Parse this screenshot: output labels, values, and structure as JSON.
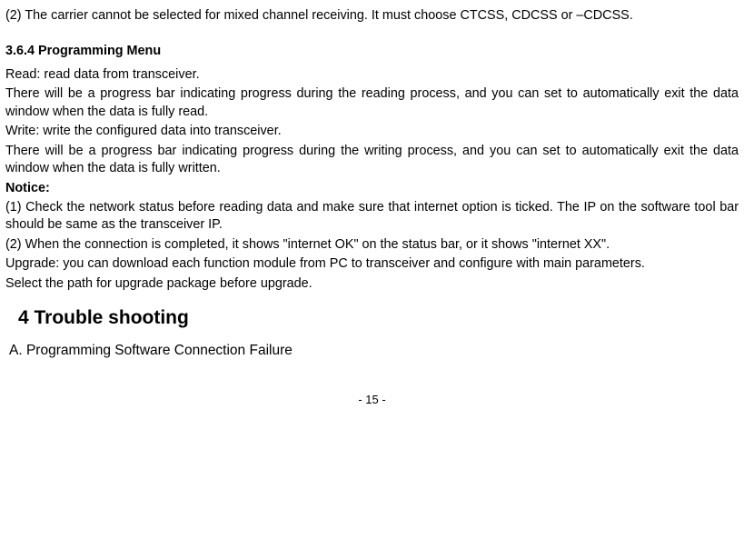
{
  "p1": " (2) The carrier cannot be selected for mixed channel receiving. It must choose CTCSS, CDCSS or –CDCSS.",
  "h1": "3.6.4 Programming Menu",
  "p2": "Read: read data from transceiver.",
  "p3": "There will be a progress bar indicating progress during the reading process, and you can set to automatically exit the data window when the data is fully read.",
  "p4": "Write: write the configured data into transceiver.",
  "p5": "There will be a progress bar indicating progress during the writing process, and you can set to automatically exit the data window when the data is fully written.",
  "notice_label": "Notice:",
  "p6": " (1) Check the network status before reading data and make sure that internet option is ticked. The IP on the software tool bar should be same as the transceiver IP.",
  "p7": " (2) When the connection is completed, it shows \"internet OK\" on the status bar, or it shows \"internet XX\".",
  "p8": "Upgrade: you can download each function module from PC to transceiver and configure with main parameters.",
  "p9": "Select the path for upgrade package before upgrade.",
  "h2": "4  Trouble shooting",
  "p10": "A.  Programming Software Connection Failure",
  "page": "- 15 -"
}
